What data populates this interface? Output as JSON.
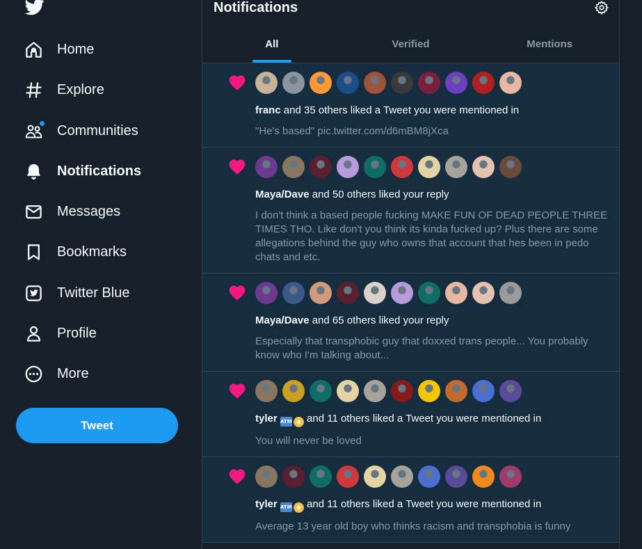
{
  "sidebar": {
    "items": [
      {
        "label": "Home",
        "icon": "home-icon"
      },
      {
        "label": "Explore",
        "icon": "hashtag-icon"
      },
      {
        "label": "Communities",
        "icon": "communities-icon"
      },
      {
        "label": "Notifications",
        "icon": "bell-icon"
      },
      {
        "label": "Messages",
        "icon": "envelope-icon"
      },
      {
        "label": "Bookmarks",
        "icon": "bookmark-icon"
      },
      {
        "label": "Twitter Blue",
        "icon": "twitter-blue-icon"
      },
      {
        "label": "Profile",
        "icon": "person-icon"
      },
      {
        "label": "More",
        "icon": "more-circle-icon"
      }
    ],
    "active_item": "Notifications",
    "tweet_label": "Tweet"
  },
  "header": {
    "title": "Notifications",
    "tabs": [
      {
        "label": "All"
      },
      {
        "label": "Verified"
      },
      {
        "label": "Mentions"
      }
    ],
    "active_tab": "All"
  },
  "colors": {
    "background": "#15202b",
    "notification_unread_bg": "#162d40",
    "accent": "#1d9bf0",
    "like_heart": "#f91880",
    "secondary_text": "#8b98a5",
    "border": "#38444d"
  },
  "notifications": [
    {
      "user": "franc",
      "action": " and 35 others liked a Tweet you were mentioned in",
      "quote": "\"He's based\" pic.twitter.com/d6mBM8jXca",
      "avatar_colors": [
        "#c9b29a",
        "#8c959f",
        "#ff9933",
        "#1b4d8a",
        "#a0523a",
        "#3a3a3a",
        "#7a1f3d",
        "#6a3fc2",
        "#b02020",
        "#e8b7a2"
      ]
    },
    {
      "user": "Maya/Dave",
      "action": " and 50 others liked your reply",
      "quote": "I don't think a based people fucking MAKE FUN OF DEAD PEOPLE THREE TIMES THO. Like don't you think its kinda fucked up? Plus there are some allegations behind the guy who owns that account that hes been in pedo chats and etc.",
      "avatar_colors": [
        "#6a3b8f",
        "#8a7560",
        "#5a2030",
        "#b79ad9",
        "#0f6d68",
        "#d0383d",
        "#e6d3a3",
        "#a8a39a",
        "#e3c2b0",
        "#6b4a3c"
      ]
    },
    {
      "user": "Maya/Dave",
      "action": " and 65 others liked your reply",
      "quote": "Especially that transphobic guy that doxxed trans people... You probably know who I'm talking about...",
      "avatar_colors": [
        "#6a3b8f",
        "#3b5a8a",
        "#d29a7a",
        "#5a2030",
        "#d9d0c8",
        "#b79ad9",
        "#0f6d68",
        "#e8b7a2",
        "#e3c2b0",
        "#9a9a9a"
      ]
    },
    {
      "user": "tyler",
      "badges": [
        "atm-icon",
        "disc-icon"
      ],
      "action": " and 11 others liked a Tweet you were mentioned in",
      "quote": "You will never be loved",
      "avatar_colors": [
        "#8a7560",
        "#c9a020",
        "#0f6d68",
        "#e6d3a3",
        "#a8a39a",
        "#8a1a1a",
        "#f2c600",
        "#c46a2a",
        "#4a6fd0",
        "#5a4a9a"
      ]
    },
    {
      "user": "tyler",
      "badges": [
        "atm-icon",
        "disc-icon"
      ],
      "action": " and 11 others liked a Tweet you were mentioned in",
      "quote": "Average 13 year old boy who thinks racism and transphobia is funny",
      "avatar_colors": [
        "#8a7560",
        "#5a2030",
        "#0f6d68",
        "#d0383d",
        "#e6d3a3",
        "#a8a39a",
        "#4a6fd0",
        "#5a4a9a",
        "#f08a1a",
        "#a03a6a"
      ]
    }
  ]
}
